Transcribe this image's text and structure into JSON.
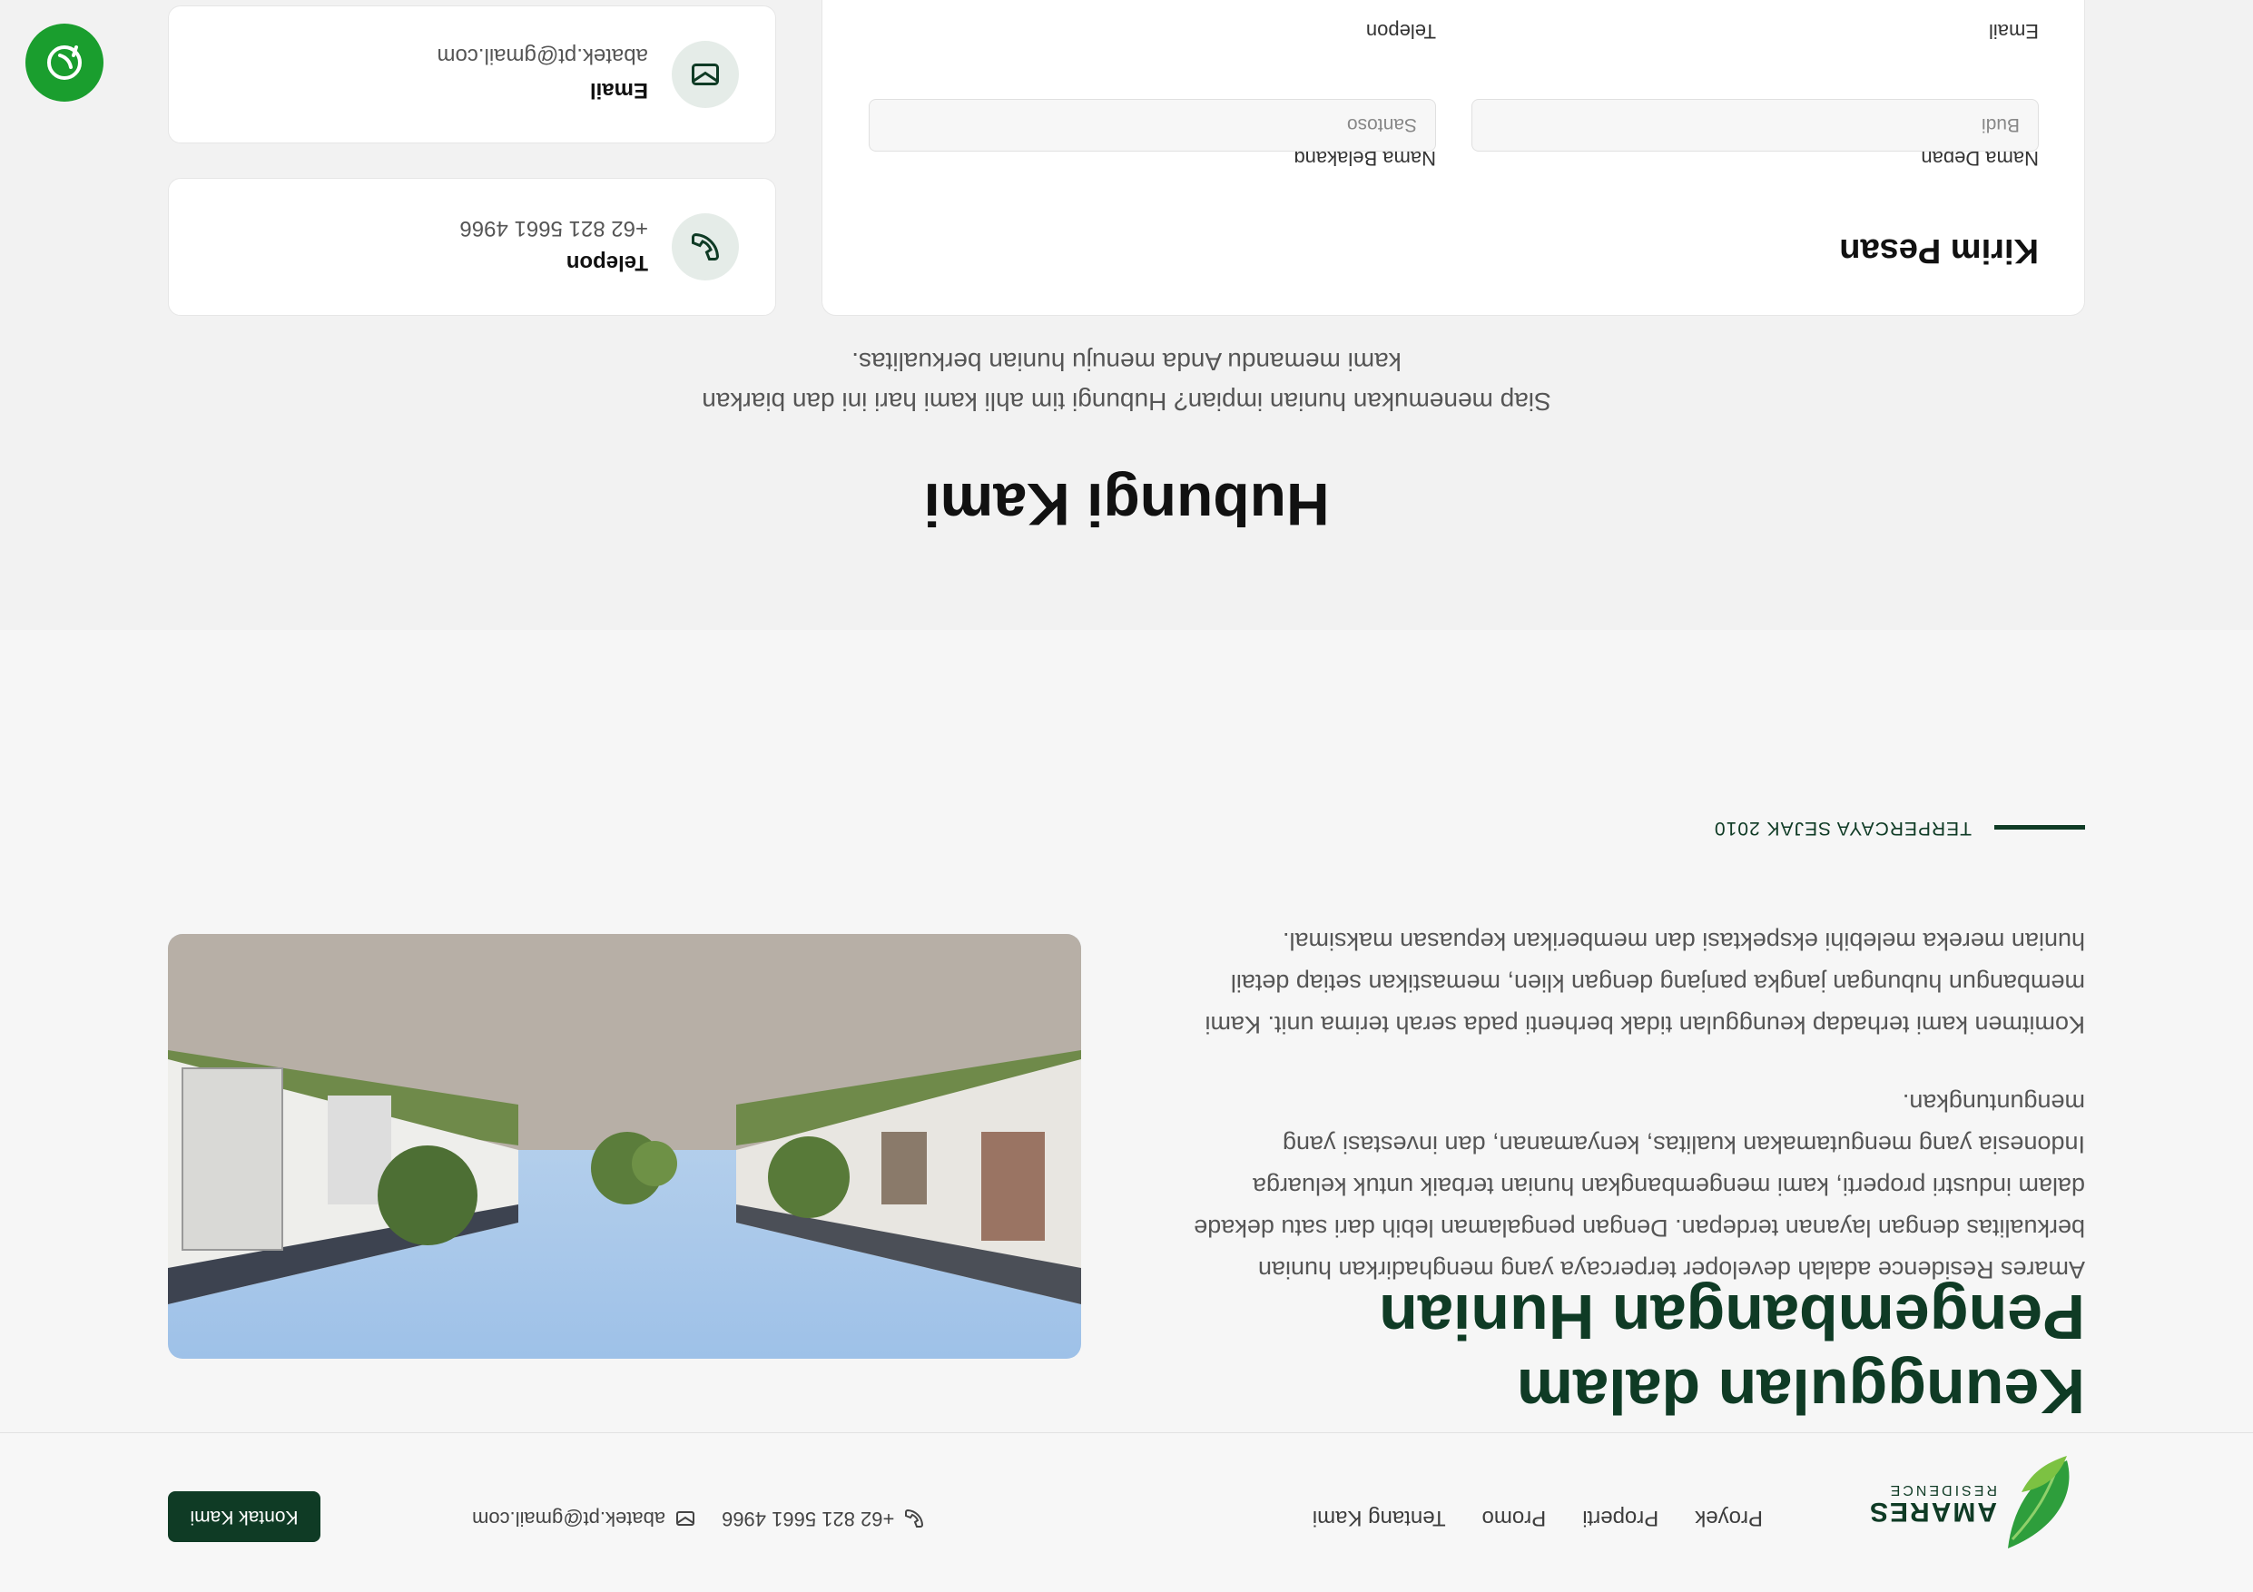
{
  "header": {
    "logo_brand": "AMARES",
    "logo_sub": "RESIDENCE",
    "nav": [
      "Proyek",
      "Properti",
      "Promo",
      "Tentang Kami"
    ],
    "phone": "+62 821 5661 4966",
    "email": "abatek.pt@gmail.com",
    "cta_label": "Kontak Kami"
  },
  "about": {
    "heading_line1": "Keunggulan dalam",
    "heading_line2": "Pengembangan Hunian",
    "paragraph1": "Amares Residence adalah developer terpercaya yang menghadirkan hunian berkualitas dengan layanan terdepan. Dengan pengalaman lebih dari satu dekade dalam industri properti, kami mengembangkan hunian terbaik untuk keluarga Indonesia yang mengutamakan kualitas, kenyamanan, dan investasi yang menguntungkan.",
    "paragraph2": "Komitmen kami terhadap keunggulan tidak berhenti pada serah terima unit. Kami membangun hubungan jangka panjang dengan klien, memastikan setiap detail hunian mereka melebihi ekspektasi dan memberikan kepuasan maksimal.",
    "tag": "TERPERCAYA SEJAK 2010"
  },
  "contact": {
    "title": "Hubungi Kami",
    "subtitle": "Siap menemukan hunian impian? Hubungi tim ahli kami hari ini dan biarkan kami memandu Anda menuju hunian berkualitas.",
    "form": {
      "title": "Kirim Pesan",
      "first_name_label": "Nama Depan",
      "first_name_placeholder": "Budi",
      "last_name_label": "Nama Belakang",
      "last_name_placeholder": "Santoso",
      "email_label": "Email",
      "phone_label": "Telepon"
    },
    "phone_card": {
      "label": "Telepon",
      "value": "+62 821 5661 4966"
    },
    "email_card": {
      "label": "Email",
      "value": "abatek.pt@gmail.com"
    }
  },
  "colors": {
    "primary": "#0f3b25",
    "accent": "#1a9e2e",
    "background": "#f6f6f6"
  },
  "icons": {
    "phone": "phone-icon",
    "email": "mail-icon",
    "fab": "whatsapp-icon"
  }
}
